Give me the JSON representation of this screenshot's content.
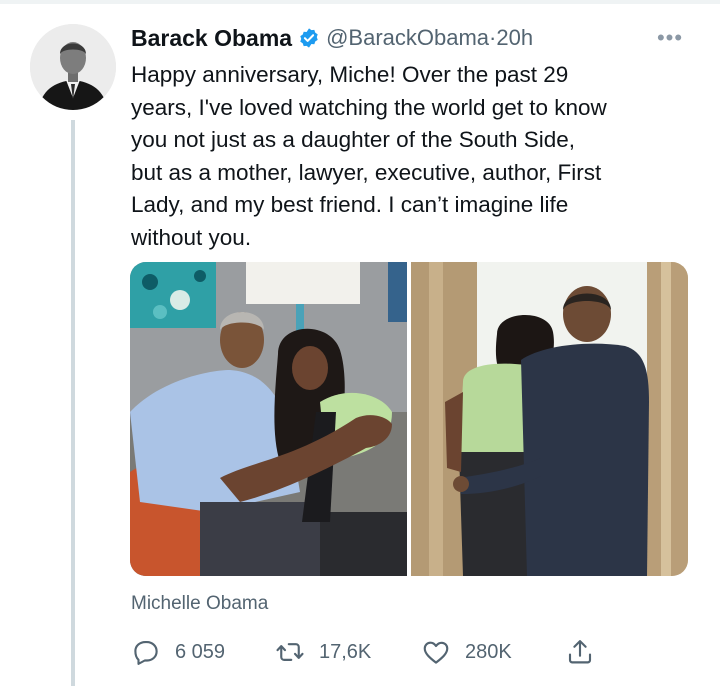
{
  "tweet": {
    "author_name": "Barack Obama",
    "handle": "@BarackObama",
    "separator": " · ",
    "time": "20h",
    "more_label": "•••",
    "text": "Happy anniversary, Miche! Over the past 29\nyears, I've loved watching the world get to know\nyou not just as a daughter of the South Side,\nbut as a mother, lawyer, executive, author, First\nLady, and my best friend. I can’t imagine life\nwithout you.",
    "tagged_user": "Michelle Obama"
  },
  "actions": {
    "reply_count": "6 059",
    "retweet_count": "17,6K",
    "like_count": "280K"
  },
  "icons": {
    "verified": "verified-badge-icon",
    "reply": "reply-icon",
    "retweet": "retweet-icon",
    "like": "heart-icon",
    "share": "share-icon"
  },
  "colors": {
    "verified_blue": "#1d9bf0",
    "secondary_text": "#536471",
    "thread_line": "#cfd9de"
  }
}
